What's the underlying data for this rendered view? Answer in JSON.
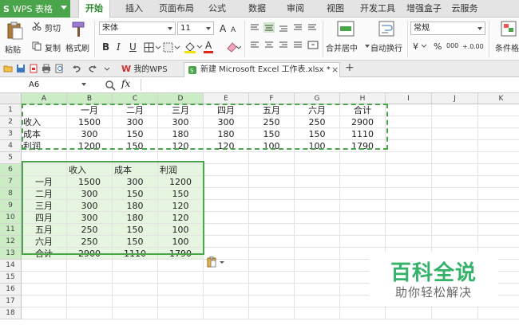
{
  "app": {
    "logo": "S",
    "title": "WPS 表格",
    "brand_color": "#4aa44a",
    "accent_color": "#2c8c2c"
  },
  "menu": {
    "tabs": [
      {
        "label": "开始",
        "active": true
      },
      {
        "label": "插入",
        "active": false
      },
      {
        "label": "页面布局",
        "active": false
      },
      {
        "label": "公式",
        "active": false
      },
      {
        "label": "数据",
        "active": false
      },
      {
        "label": "审阅",
        "active": false
      },
      {
        "label": "视图",
        "active": false
      },
      {
        "label": "开发工具",
        "active": false
      },
      {
        "label": "增强盒子",
        "active": false
      },
      {
        "label": "云服务",
        "active": false
      }
    ]
  },
  "ribbon": {
    "paste": "粘贴",
    "cut": "剪切",
    "copy": "复制",
    "format_painter": "格式刷",
    "font_name": "宋体",
    "font_size": "11",
    "bold": "B",
    "italic": "I",
    "underline": "U",
    "font_color_letter": "A",
    "merge_center": "合并居中",
    "wrap_text": "自动换行",
    "number_format": "常规",
    "percent": "%",
    "comma": "000",
    "conditional_format": "条件格"
  },
  "doc_tabs": {
    "wps": "我的WPS",
    "excel": "新建 Microsoft Excel 工作表.xlsx *",
    "add": "+"
  },
  "formula_bar": {
    "name_box": "A6",
    "fx": "fx",
    "value": ""
  },
  "sheet": {
    "columns": [
      "A",
      "B",
      "C",
      "D",
      "E",
      "F",
      "G",
      "H",
      "I",
      "J",
      "K"
    ],
    "selected_columns": [
      "A",
      "B",
      "C",
      "D"
    ],
    "rows": [
      "1",
      "2",
      "3",
      "4",
      "5",
      "6",
      "7",
      "8",
      "9",
      "10",
      "11",
      "12",
      "13",
      "14",
      "15",
      "16",
      "17",
      "18"
    ],
    "selected_rows": [
      "6",
      "7",
      "8",
      "9",
      "10",
      "11",
      "12",
      "13"
    ],
    "table1": {
      "header": [
        "",
        "一月",
        "二月",
        "三月",
        "四月",
        "五月",
        "六月",
        "合计"
      ],
      "rows": [
        [
          "收入",
          "1500",
          "300",
          "300",
          "300",
          "250",
          "250",
          "2900"
        ],
        [
          "成本",
          "300",
          "150",
          "180",
          "180",
          "150",
          "150",
          "1110"
        ],
        [
          "利润",
          "1200",
          "150",
          "120",
          "120",
          "100",
          "100",
          "1790"
        ]
      ]
    },
    "table2": {
      "header": [
        "",
        "收入",
        "成本",
        "利润"
      ],
      "rows": [
        [
          "一月",
          "1500",
          "300",
          "1200"
        ],
        [
          "二月",
          "300",
          "150",
          "150"
        ],
        [
          "三月",
          "300",
          "180",
          "120"
        ],
        [
          "四月",
          "300",
          "180",
          "120"
        ],
        [
          "五月",
          "250",
          "150",
          "100"
        ],
        [
          "六月",
          "250",
          "150",
          "100"
        ],
        [
          "合计",
          "2900",
          "1110",
          "1790"
        ]
      ]
    }
  },
  "watermark": {
    "title": "百科全说",
    "subtitle": "助你轻松解决"
  }
}
